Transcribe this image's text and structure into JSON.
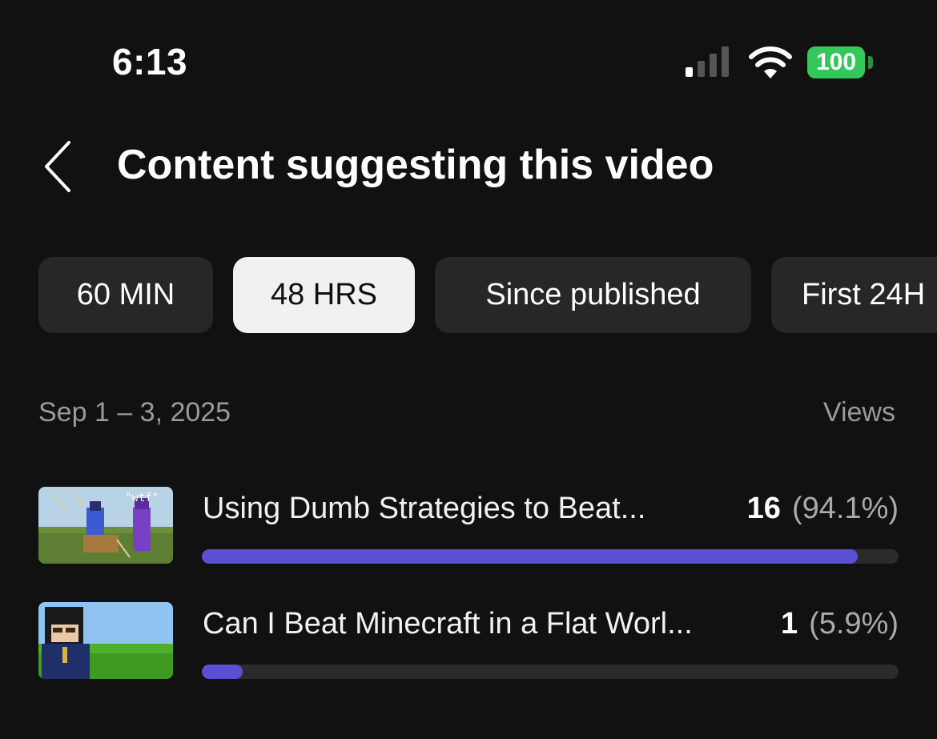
{
  "status_bar": {
    "time": "6:13",
    "battery": "100",
    "battery_color": "#34c759"
  },
  "header": {
    "back_icon": "chevron-left-icon",
    "title": "Content suggesting this video"
  },
  "filters": {
    "chips": [
      {
        "label": "60 MIN",
        "active": false
      },
      {
        "label": "48 HRS",
        "active": true
      },
      {
        "label": "Since published",
        "active": false
      },
      {
        "label": "First 24H",
        "active": false
      }
    ]
  },
  "list": {
    "date_range": "Sep 1 – 3, 2025",
    "views_header": "Views",
    "accent_color": "#5b4fd6",
    "items": [
      {
        "title": "Using Dumb Strategies to Beat...",
        "views": "16",
        "percent_label": "(94.1%)",
        "share": 0.941
      },
      {
        "title": "Can I Beat Minecraft in a Flat Worl...",
        "views": "1",
        "percent_label": "(5.9%)",
        "share": 0.059
      }
    ]
  }
}
